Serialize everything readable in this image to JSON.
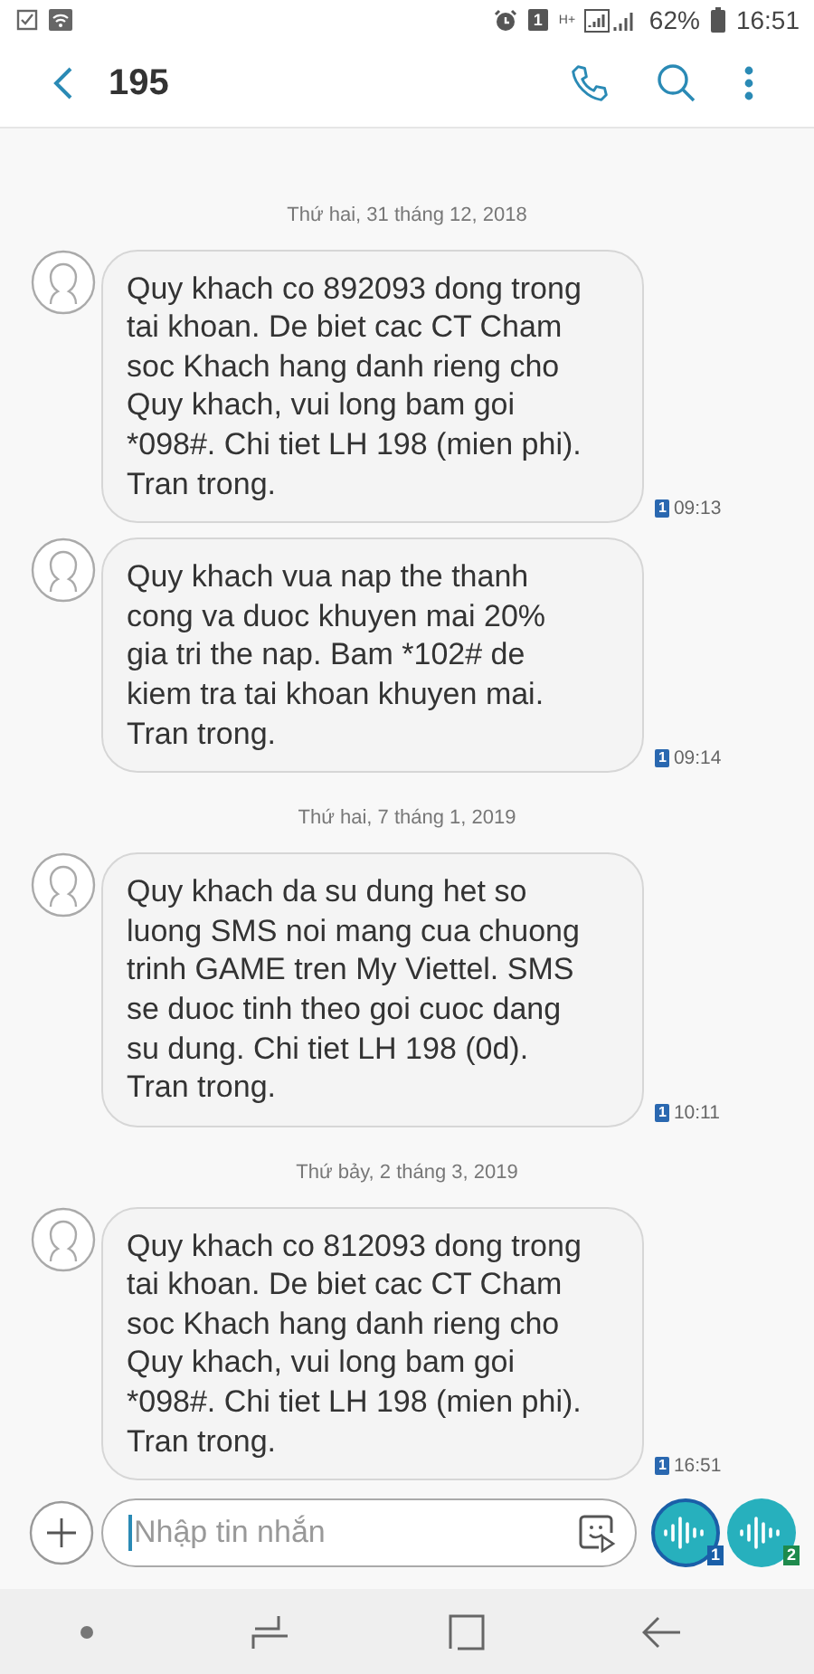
{
  "status_bar": {
    "sim": "1",
    "network": "H+",
    "battery": "62%",
    "time": "16:51"
  },
  "header": {
    "title": "195"
  },
  "conversation": [
    {
      "kind": "date",
      "text": "Thứ hai, 31 tháng 12, 2018"
    },
    {
      "kind": "message",
      "text": "Quy khach co 892093 dong trong tai khoan. De biet cac CT Cham soc Khach hang danh rieng cho Quy khach, vui long bam goi *098#. Chi tiet LH 198 (mien phi). Tran trong.",
      "sim": "1",
      "time": "09:13"
    },
    {
      "kind": "message",
      "text": "Quy khach vua nap the thanh cong va duoc khuyen mai 20% gia tri the nap. Bam *102# de kiem tra tai khoan khuyen mai. Tran trong.",
      "sim": "1",
      "time": "09:14"
    },
    {
      "kind": "date",
      "text": "Thứ hai, 7 tháng 1, 2019"
    },
    {
      "kind": "message",
      "text": "Quy khach da su dung het so luong SMS noi mang cua chuong trinh GAME tren My Viettel. SMS se duoc tinh theo goi cuoc dang su dung. Chi tiet LH 198 (0d). Tran trong.",
      "sim": "1",
      "time": "10:11"
    },
    {
      "kind": "date",
      "text": "Thứ bảy, 2 tháng 3, 2019"
    },
    {
      "kind": "message",
      "text": "Quy khach co 812093 dong trong tai khoan. De biet cac CT Cham soc Khach hang danh rieng cho Quy khach, vui long bam goi *098#. Chi tiet LH 198 (mien phi). Tran trong.",
      "sim": "1",
      "time": "16:51"
    }
  ],
  "composer": {
    "placeholder": "Nhập tin nhắn",
    "send_buttons": [
      {
        "sim": "1",
        "color": "#1a5fa8",
        "selected": true
      },
      {
        "sim": "2",
        "color": "#1e8a4c",
        "selected": false
      }
    ]
  }
}
